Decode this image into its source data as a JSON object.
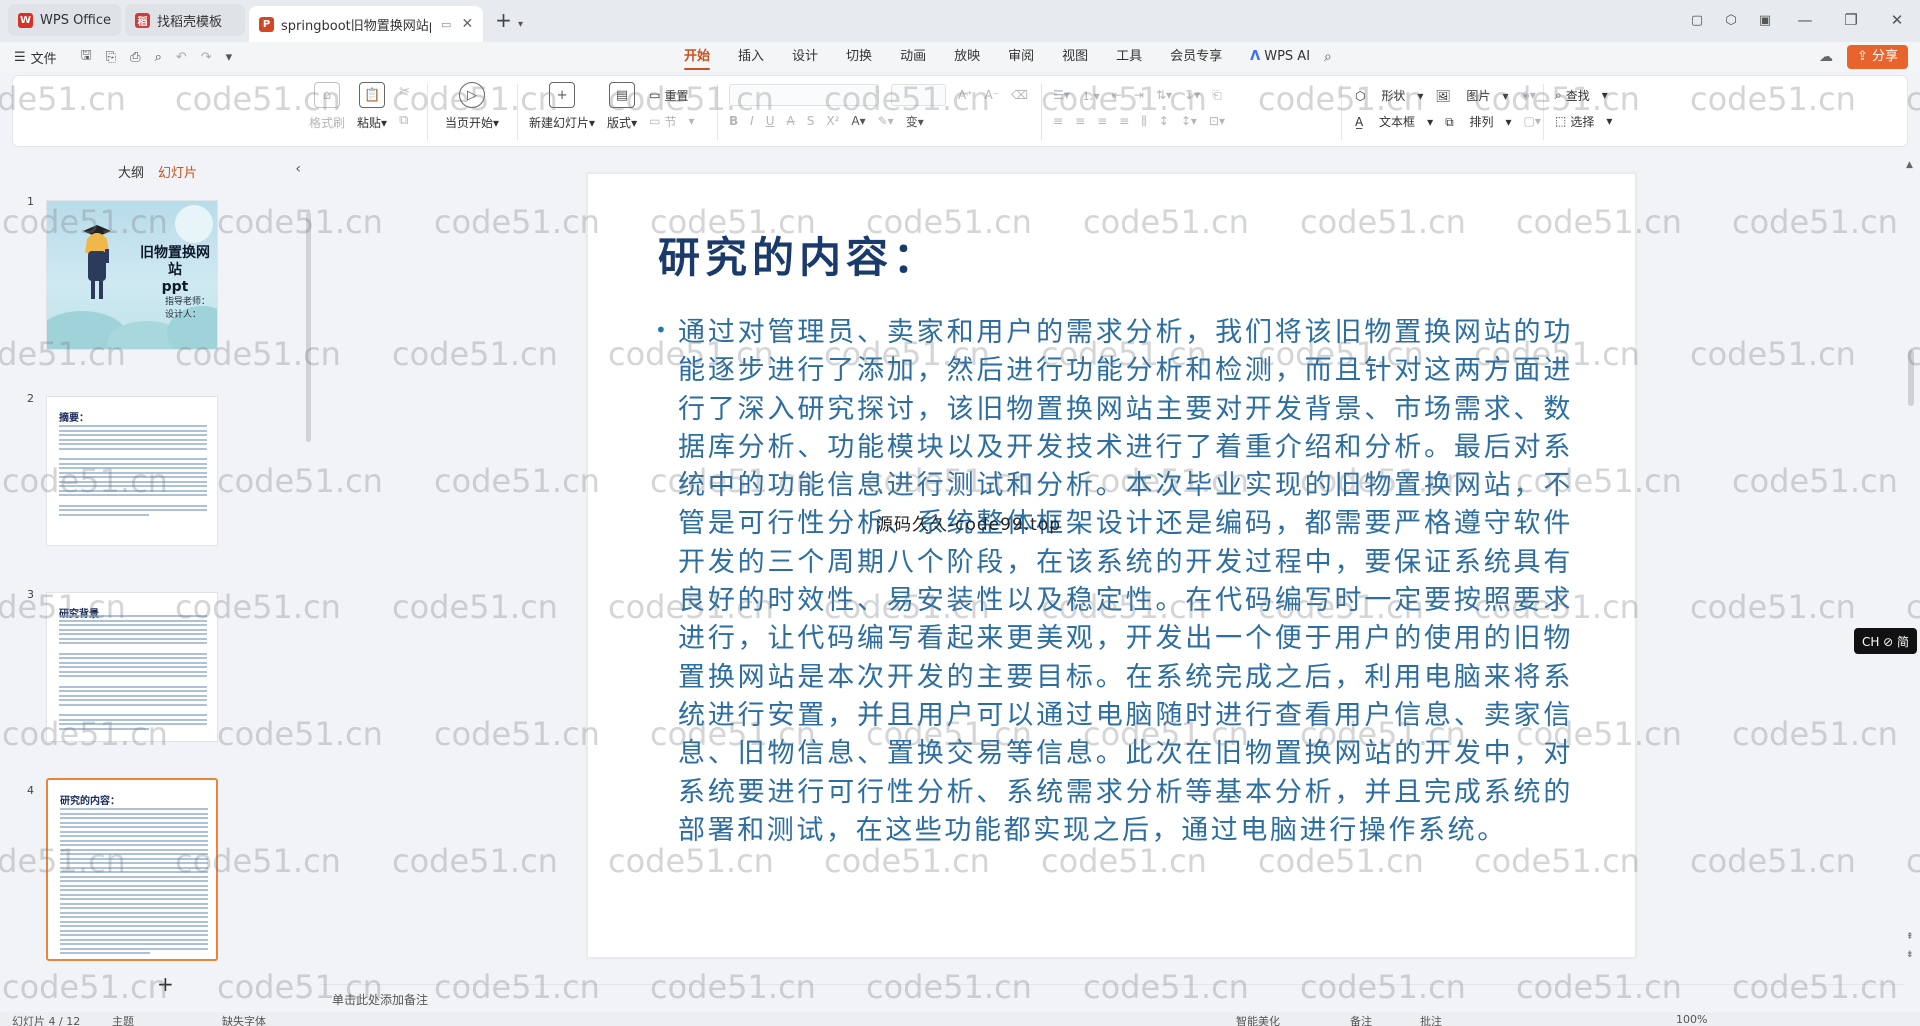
{
  "tabs": [
    {
      "label": "WPS Office",
      "icon": "wps-logo-icon",
      "color": "#d93025"
    },
    {
      "label": "找稻壳模板",
      "icon": "docer-icon",
      "color": "#d23b3b"
    },
    {
      "label": "springboot旧物置换网站pp",
      "icon": "ppt-icon",
      "color": "#d24726"
    }
  ],
  "menu": {
    "file": "文件",
    "ribbon_tabs": [
      "开始",
      "插入",
      "设计",
      "切换",
      "动画",
      "放映",
      "审阅",
      "视图",
      "工具",
      "会员专享"
    ],
    "active_tab": "开始",
    "wps_ai": "WPS AI",
    "share": "分享"
  },
  "ribbon": {
    "format_painter": "格式刷",
    "paste": "粘贴",
    "play_from_current": "当页开始",
    "new_slide": "新建幻灯片",
    "layout": "版式",
    "reset": "重置",
    "section": "节",
    "shape": "形状",
    "picture": "图片",
    "textbox": "文本框",
    "arrange": "排列",
    "find": "查找",
    "select": "选择"
  },
  "panel": {
    "outline": "大纲",
    "slides": "幻灯片",
    "thumbs": [
      {
        "num": "1",
        "title": "旧物置换网站\nppt",
        "lines": [
          "指导老师：",
          "设计人："
        ]
      },
      {
        "num": "2",
        "title": "摘要："
      },
      {
        "num": "3",
        "title": "研究背景"
      },
      {
        "num": "4",
        "title": "研究的内容："
      }
    ],
    "add": "+"
  },
  "slide": {
    "title": "研究的内容：",
    "bullet": "•",
    "body": "通过对管理员、卖家和用户的需求分析，我们将该旧物置换网站的功能逐步进行了添加，然后进行功能分析和检测，而且针对这两方面进行了深入研究探讨，该旧物置换网站主要对开发背景、市场需求、数据库分析、功能模块以及开发技术进行了着重介绍和分析。最后对系统中的功能信息进行测试和分析。本次毕业实现的旧物置换网站，不管是可行性分析、系统整体框架设计还是编码，都需要严格遵守软件开发的三个周期八个阶段，在该系统的开发过程中，要保证系统具有良好的时效性、易安装性以及稳定性。在代码编写时一定要按照要求进行，让代码编写看起来更美观，开发出一个便于用户的使用的旧物置换网站是本次开发的主要目标。在系统完成之后，利用电脑来将系统进行安置，并且用户可以通过电脑随时进行查看用户信息、卖家信息、旧物信息、置换交易等信息。此次在旧物置换网站的开发中，对系统要进行可行性分析、系统需求分析等基本分析，并且完成系统的部署和测试，在这些功能都实现之后，通过电脑进行操作系统。",
    "overlay_text": "源码久久-code99.top"
  },
  "notes_placeholder": "单击此处添加备注",
  "status": {
    "slide_info": "幻灯片 4 / 12",
    "theme": "主题",
    "font_missing": "缺失字体",
    "beautify": "智能美化",
    "notes": "备注",
    "comments": "批注",
    "zoom": "100%"
  },
  "ime": "CH ⊘ 简",
  "watermark": "code51.cn"
}
